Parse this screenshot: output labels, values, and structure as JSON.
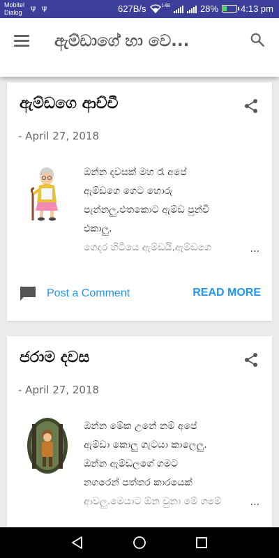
{
  "status_bar": {
    "carrier_line1": "Mobitel",
    "carrier_line2": "Dialog",
    "usb1": "ψ",
    "usb2": "ψ",
    "network_speed": "627B/s",
    "lte_label": "14B",
    "battery_percent": "28%",
    "battery_level": 0.28,
    "time": "4:13 pm"
  },
  "header": {
    "menu_icon": "hamburger-icon",
    "title": "ඇම්ඩාගේ හා වෙ...",
    "search_icon": "search-icon"
  },
  "posts": [
    {
      "title": "ඇම්ඩගෙ ආච්චී",
      "date": "- April 27, 2018",
      "thumbnail": "grandmother-illustration",
      "snippet_lines": [
        "ඔන්න දවසක් මහ රෑ අපේ",
        "ඇම්ඩගෙ ගෙට හොරු",
        "පැන්නලු.එතකොට ඇම්ඩ පුන්චි",
        "එකාලු.",
        "ගෙදර හිටියෙ ඇම්ඩයි,ඇම්ඩගෙ"
      ],
      "ellipsis": "...",
      "comment_label": "Post a Comment",
      "read_more": "READ MORE"
    },
    {
      "title": "ජරාම දවස",
      "date": "- April 27, 2018",
      "thumbnail": "boy-in-forest-illustration",
      "snippet_lines": [
        "ඔන්න මේක උනේ නම් අපේ",
        "ඇම්ඩා කොලු ගැටයා කාලෙලු.",
        "ඔන්න ඇම්ඩලගේ ගමට",
        "නගරෙන් පත්තර කාරයෙක්",
        "ආවලු.මෙයාට ඕන වුනා මේ ගමේ"
      ],
      "ellipsis": "..."
    }
  ],
  "nav_bar": {
    "back_icon": "back-triangle-icon",
    "home_icon": "home-circle-icon",
    "recents_icon": "recents-square-icon"
  },
  "colors": {
    "status_bar": "#3b3f99",
    "accent": "#2196f3",
    "battery_fill": "#4cd964"
  }
}
